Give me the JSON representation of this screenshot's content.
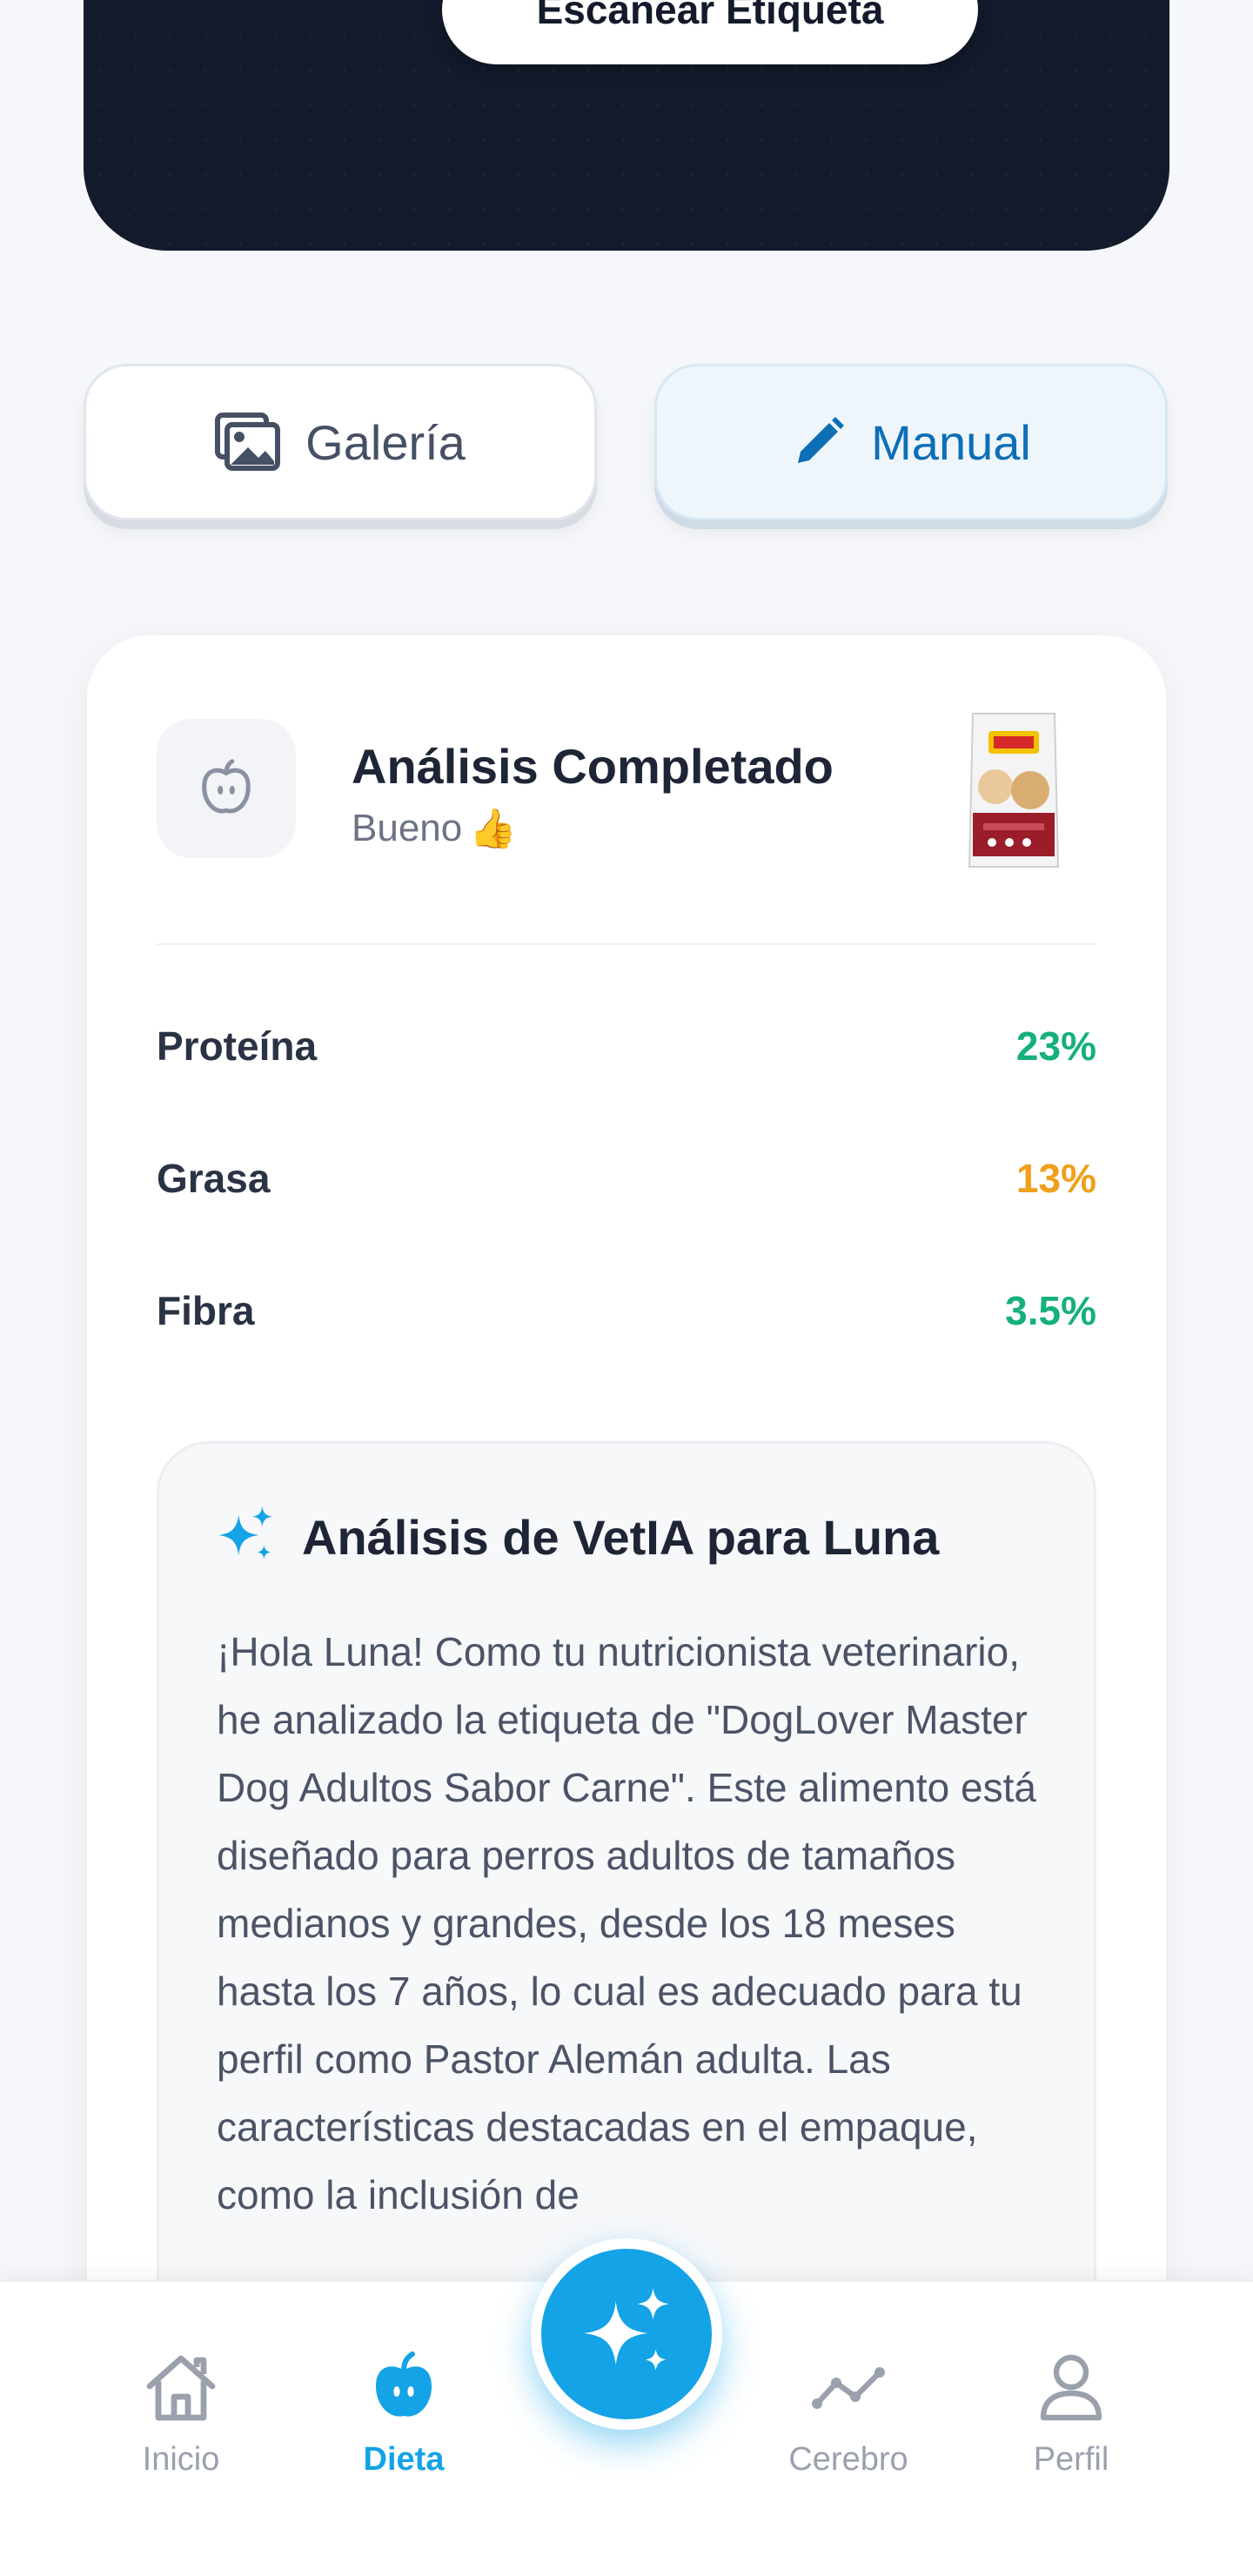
{
  "hero": {
    "scan_label": "Escanear Etiqueta"
  },
  "options": {
    "gallery_label": "Galería",
    "manual_label": "Manual"
  },
  "result": {
    "title": "Análisis Completado",
    "rating": "Bueno",
    "rating_emoji": "👍",
    "nutrients": [
      {
        "label": "Proteína",
        "value": "23%",
        "color": "#16b07a"
      },
      {
        "label": "Grasa",
        "value": "13%",
        "color": "#f0a01c"
      },
      {
        "label": "Fibra",
        "value": "3.5%",
        "color": "#16b07a"
      }
    ]
  },
  "ai": {
    "title": "Análisis de VetIA para Luna",
    "text": "¡Hola Luna! Como tu nutricionista veterinario, he analizado la etiqueta de \"DogLover Master Dog Adultos Sabor Carne\". Este alimento está diseñado para perros adultos de tamaños medianos y grandes, desde los 18 meses hasta los 7 años, lo cual es adecuado para tu perfil como Pastor Alemán adulta. Las características destacadas en el empaque, como la inclusión de"
  },
  "nav": {
    "items": [
      {
        "label": "Inicio",
        "icon": "home-icon"
      },
      {
        "label": "Dieta",
        "icon": "apple-icon"
      },
      {
        "label": "Cerebro",
        "icon": "trend-icon"
      },
      {
        "label": "Perfil",
        "icon": "user-icon"
      }
    ],
    "fab_icon": "sparkle-icon"
  },
  "colors": {
    "accent": "#13a3e6",
    "dark": "#121a2b",
    "good": "#16b07a",
    "warn": "#f0a01c"
  }
}
